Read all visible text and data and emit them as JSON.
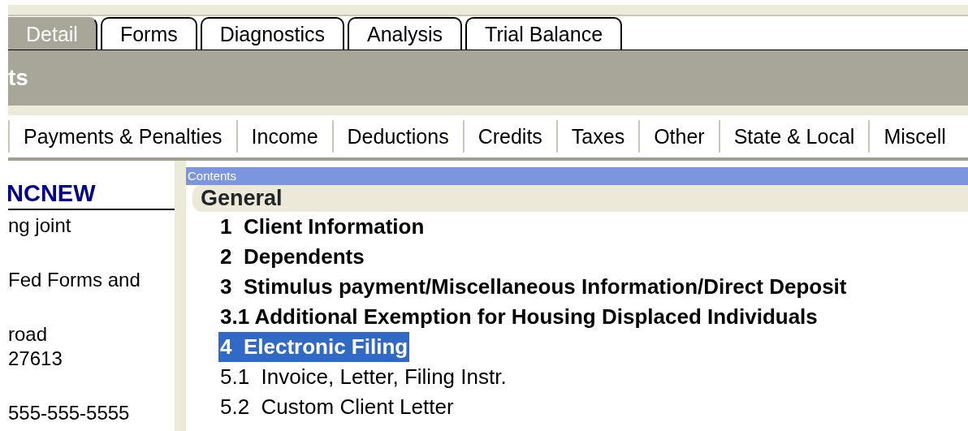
{
  "tabs": [
    {
      "label": "Detail",
      "selected": true
    },
    {
      "label": "Forms",
      "selected": false
    },
    {
      "label": "Diagnostics",
      "selected": false
    },
    {
      "label": "Analysis",
      "selected": false
    },
    {
      "label": "Trial Balance",
      "selected": false
    }
  ],
  "header": {
    "title": "ts"
  },
  "categories": [
    "Payments & Penalties",
    "Income",
    "Deductions",
    "Credits",
    "Taxes",
    "Other",
    "State & Local",
    "Miscell"
  ],
  "client": {
    "name": "NCNEW",
    "lines": [
      "ng joint",
      "Fed Forms and",
      "road",
      "27613",
      "555-555-5555"
    ]
  },
  "contents": {
    "title": "Contents",
    "group": "General",
    "items": [
      {
        "text": "1  Client Information",
        "kind": "bold",
        "selected": false
      },
      {
        "text": "2  Dependents",
        "kind": "bold",
        "selected": false
      },
      {
        "text": "3  Stimulus payment/Miscellaneous Information/Direct Deposit",
        "kind": "bold",
        "selected": false
      },
      {
        "text": "3.1 Additional Exemption for Housing Displaced Individuals",
        "kind": "bold",
        "selected": false
      },
      {
        "text": "4  Electronic Filing",
        "kind": "bold",
        "selected": true
      },
      {
        "text": "5.1  Invoice, Letter, Filing Instr.",
        "kind": "plain",
        "selected": false
      },
      {
        "text": "5.2  Custom Client Letter",
        "kind": "plain",
        "selected": false
      }
    ]
  }
}
